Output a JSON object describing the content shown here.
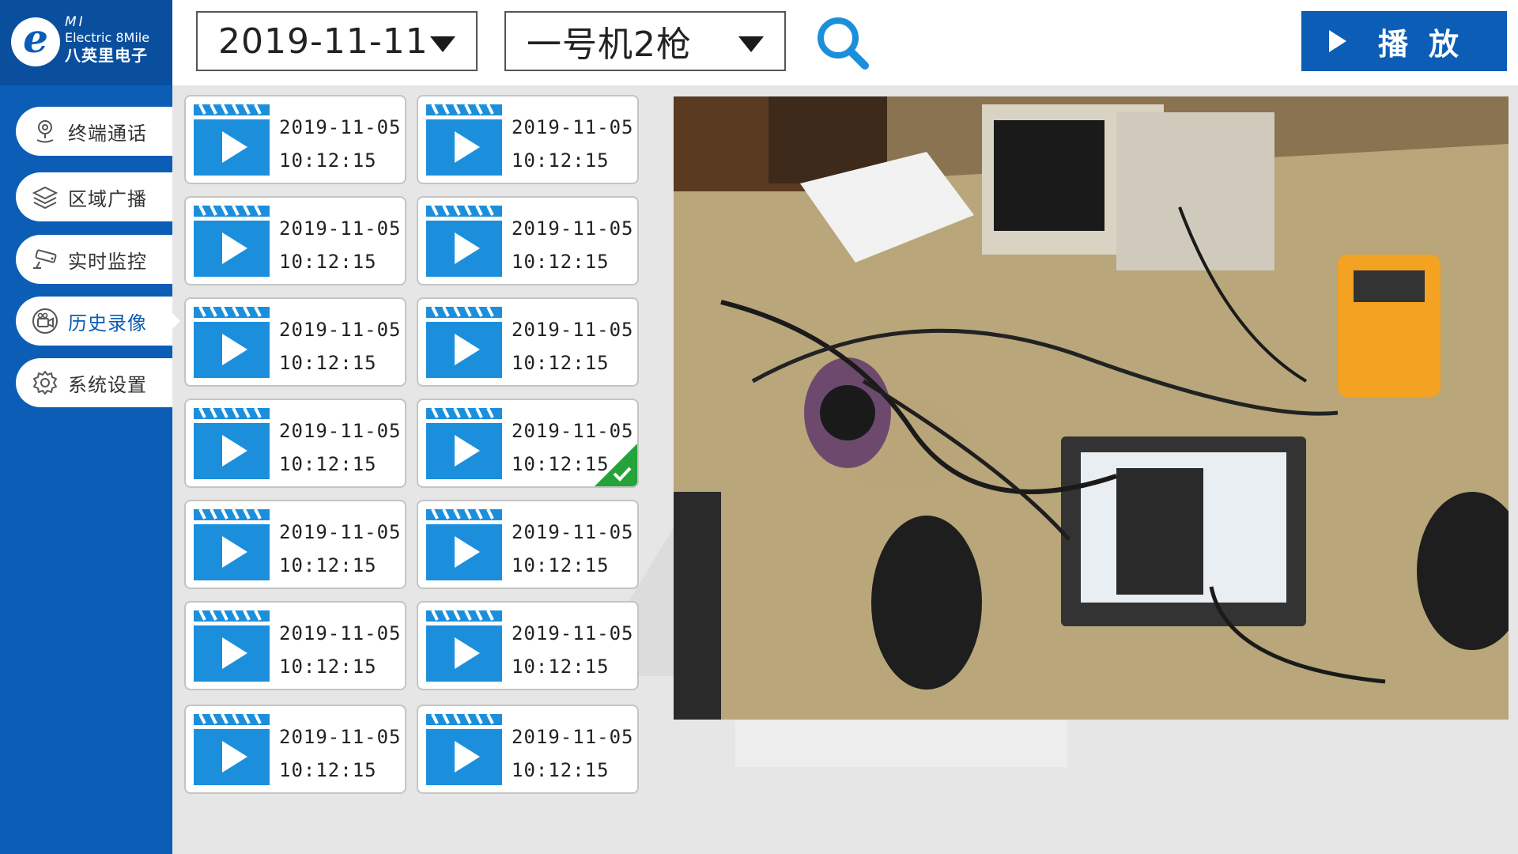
{
  "brand": {
    "logo_letter": "e",
    "line1": "MI",
    "line2": "Electric 8Mile",
    "line3": "八英里电子"
  },
  "sidebar": {
    "items": [
      {
        "label": "终端通话",
        "icon": "map-pin-icon",
        "active": false
      },
      {
        "label": "区域广播",
        "icon": "layers-icon",
        "active": false
      },
      {
        "label": "实时监控",
        "icon": "cctv-camera-icon",
        "active": false
      },
      {
        "label": "历史录像",
        "icon": "video-camera-icon",
        "active": true
      },
      {
        "label": "系统设置",
        "icon": "gear-icon",
        "active": false
      }
    ]
  },
  "toolbar": {
    "date_value": "2019-11-11",
    "device_value": "一号机2枪",
    "search_icon": "search-icon",
    "play_label": "播放"
  },
  "videos": [
    {
      "date": "2019-11-05",
      "time": "10:12:15",
      "selected": false
    },
    {
      "date": "2019-11-05",
      "time": "10:12:15",
      "selected": false
    },
    {
      "date": "2019-11-05",
      "time": "10:12:15",
      "selected": false
    },
    {
      "date": "2019-11-05",
      "time": "10:12:15",
      "selected": false
    },
    {
      "date": "2019-11-05",
      "time": "10:12:15",
      "selected": false
    },
    {
      "date": "2019-11-05",
      "time": "10:12:15",
      "selected": false
    },
    {
      "date": "2019-11-05",
      "time": "10:12:15",
      "selected": false
    },
    {
      "date": "2019-11-05",
      "time": "10:12:15",
      "selected": true
    },
    {
      "date": "2019-11-05",
      "time": "10:12:15",
      "selected": false
    },
    {
      "date": "2019-11-05",
      "time": "10:12:15",
      "selected": false
    },
    {
      "date": "2019-11-05",
      "time": "10:12:15",
      "selected": false
    },
    {
      "date": "2019-11-05",
      "time": "10:12:15",
      "selected": false
    },
    {
      "date": "2019-11-05",
      "time": "10:12:15",
      "selected": false
    },
    {
      "date": "2019-11-05",
      "time": "10:12:15",
      "selected": false
    }
  ],
  "colors": {
    "primary": "#0b5db5",
    "logo_bg": "#0a4f9e",
    "accent_icon": "#1c8fdc",
    "thumb": "#1c8fdc",
    "check": "#24a33a",
    "background": "#e6e6e6"
  }
}
